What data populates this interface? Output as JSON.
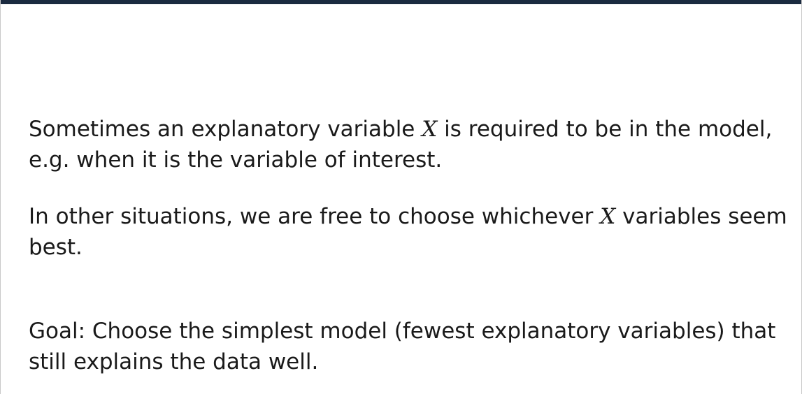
{
  "paragraphs": [
    {
      "before": "Sometimes an explanatory variable ",
      "math": "X",
      "after": " is required to be in the model, e.g. when it is the variable of interest."
    },
    {
      "before": "In other situations, we are free to choose whichever ",
      "math": "X",
      "after": " variables seem best."
    },
    {
      "text": "Goal: Choose the simplest model (fewest explanatory variables) that still explains the data well."
    }
  ],
  "colors": {
    "top_bar": "#1b2b40",
    "text": "#1a1a1a",
    "background": "#ffffff"
  }
}
